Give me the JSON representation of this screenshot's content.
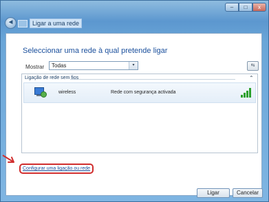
{
  "window": {
    "title": "Ligar a uma rede",
    "back_glyph": "◄",
    "min_glyph": "–",
    "max_glyph": "□",
    "close_glyph": "x"
  },
  "heading": "Seleccionar uma rede à qual pretende ligar",
  "filter": {
    "label": "Mostrar",
    "value": "Todas",
    "arrow_glyph": "▾"
  },
  "refresh_glyph": "⇆",
  "list": {
    "group_header": "Ligação de rede sem fios",
    "collapse_glyph": "⌃",
    "networks": [
      {
        "name": "wireless",
        "security": "Rede com segurança activada",
        "signal_bars": 4
      }
    ]
  },
  "setup_link": "Configurar uma ligação ou rede",
  "buttons": {
    "connect": "Ligar",
    "cancel": "Cancelar"
  },
  "colors": {
    "accent": "#1a4f9c",
    "highlight_circle": "#d02d2d",
    "signal": "#2ba02b"
  }
}
